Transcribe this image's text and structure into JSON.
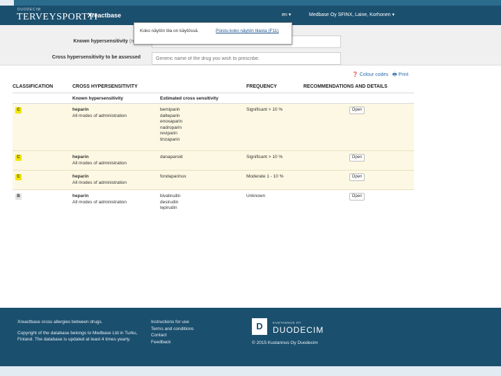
{
  "header": {
    "brand_small": "DUODECIM",
    "brand_big": "TERVEYSPORTTI",
    "app_name": "Xreactbase",
    "language": "en ▾",
    "user": "Medbase Oy SFINX, Laine, Korhonen ▾"
  },
  "form": {
    "known_label": "Known hypersensitivity",
    "known_required": "(require",
    "known_value": "",
    "cross_label": "Cross hypersensitivity to be assessed",
    "cross_placeholder": "Generic name of the drug you wish to prescribe."
  },
  "tooltip": {
    "message": "Koko näytön tila on käytössä.",
    "link": "Poistu koko näytön tilasta (F11)"
  },
  "tools": {
    "colour_codes": "Colour codes",
    "print": "Print"
  },
  "table": {
    "headers": [
      "CLASSIFICATION",
      "CROSS HYPERSENSITIVITY",
      "FREQUENCY",
      "RECOMMENDATIONS AND DETAILS"
    ],
    "subheaders": [
      "Known hypersensitivity",
      "Estimated cross sensitivity"
    ],
    "rows": [
      {
        "class": "C",
        "known": "heparin",
        "mode": "All modes of administration",
        "estimated": [
          "bemiparin",
          "dalteparin",
          "enoxaparin",
          "nadroparin",
          "reviparin",
          "tinzaparin"
        ],
        "frequency": "Significant > 10 %",
        "action": "Open"
      },
      {
        "class": "C",
        "known": "heparin",
        "mode": "All modes of administration",
        "estimated": [
          "danaparoid"
        ],
        "frequency": "Significant > 10 %",
        "action": "Open"
      },
      {
        "class": "C",
        "known": "heparin",
        "mode": "All modes of administration",
        "estimated": [
          "fondaparinux"
        ],
        "frequency": "Moderate 1 - 10 %",
        "action": "Open"
      },
      {
        "class": "B",
        "known": "heparin",
        "mode": "All modes of administration",
        "estimated": [
          "bivalirudin",
          "desirudin",
          "lepirudin"
        ],
        "frequency": "Unknown",
        "action": "Open"
      }
    ]
  },
  "footer": {
    "tagline": "Xreactbase cross allergies between drugs.",
    "copyright_text": "Copyright of the database belongs to Medbase Ltd in Turku, Finland. The database is updated at least 4 times yearly.",
    "links": [
      "Instructions for use",
      "Terms and conditions",
      "Contact",
      "Feedback"
    ],
    "logo_letter": "D",
    "logo_small": "KUSTANNUS OY",
    "logo_big": "DUODECIM",
    "copyright": "© 2015 Kustannus Oy Duodecim"
  },
  "colors": {
    "header_bg": "#1b4f6e",
    "badge_c": "#f2e600",
    "badge_b": "#e2e2e2",
    "row_highlight": "#fcf8e3"
  }
}
